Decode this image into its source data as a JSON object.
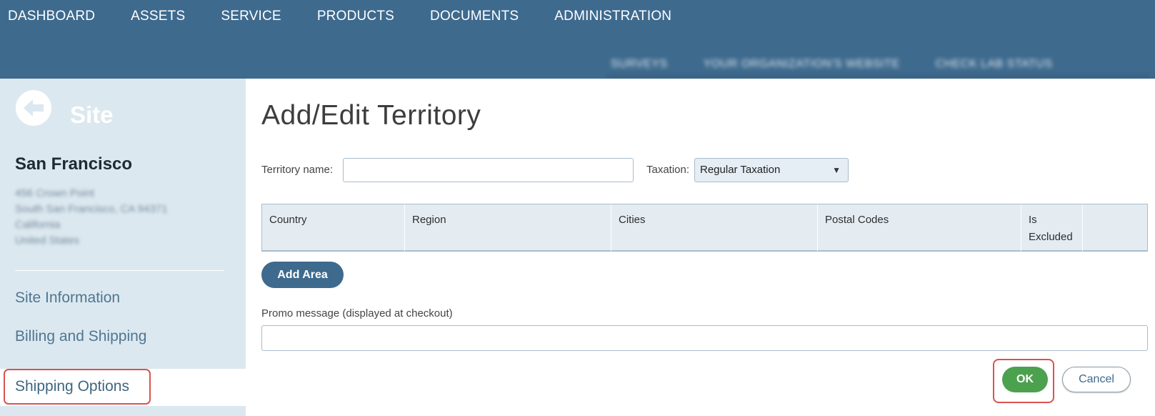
{
  "main_nav": [
    "DASHBOARD",
    "ASSETS",
    "SERVICE",
    "PRODUCTS",
    "DOCUMENTS",
    "ADMINISTRATION"
  ],
  "sub_nav": [
    "SURVEYS",
    "YOUR ORGANIZATION'S WEBSITE",
    "CHECK LAB STATUS"
  ],
  "sidebar": {
    "back_icon": "arrow-left-circle-icon",
    "section_label": "Site",
    "site_name": "San Francisco",
    "address_lines": [
      "456 Crown Point",
      "South San Francisco, CA 94371",
      "California",
      "United States"
    ],
    "links": [
      "Site Information",
      "Billing and Shipping",
      "Shipping Options"
    ],
    "active_link": "Shipping Options"
  },
  "form": {
    "title": "Add/Edit Territory",
    "territory_label": "Territory name:",
    "territory_value": "",
    "taxation_label": "Taxation:",
    "taxation_value": "Regular Taxation",
    "columns": [
      "Country",
      "Region",
      "Cities",
      "Postal Codes",
      "Is Excluded",
      ""
    ],
    "add_area_label": "Add Area",
    "promo_label": "Promo message (displayed at checkout)",
    "promo_value": "",
    "ok_label": "OK",
    "cancel_label": "Cancel"
  },
  "colors": {
    "header_bg": "#3e6a8e",
    "sidebar_bg": "#dce8ef",
    "highlight": "#d9534f",
    "ok_green": "#4ca14f"
  }
}
